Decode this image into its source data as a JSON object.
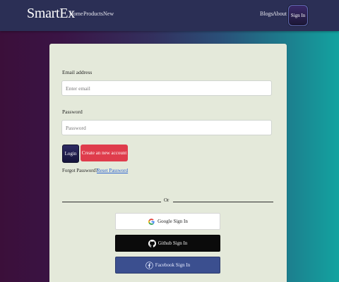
{
  "navbar": {
    "brand": "SmartEx",
    "links": [
      "Home",
      "Products",
      "New"
    ],
    "right_links": [
      "Blogs",
      "About"
    ],
    "signin_label": "Sign In"
  },
  "form": {
    "email_label": "Email address",
    "email_placeholder": "Enter email",
    "password_label": "Password",
    "password_placeholder": "Password",
    "login_button": "Login",
    "create_button": "Create an new account",
    "forgot_text": "Forgot Password?",
    "reset_link": "Reset Password",
    "divider_text": "Or"
  },
  "social": {
    "google_label": "Google Sign In",
    "github_label": "Github Sign In",
    "facebook_label": "Facebook Sign In",
    "google_icon": "google-icon",
    "github_icon": "github-icon",
    "facebook_icon": "facebook-icon"
  },
  "colors": {
    "navbar_bg": "#2b2f55",
    "card_bg": "#e4e9da",
    "create_button_bg": "#df3c4c",
    "login_button_bg": "#15143a",
    "facebook_bg": "#3b4f8f",
    "github_bg": "#0b0b0b",
    "reset_link": "#2b62d0"
  }
}
